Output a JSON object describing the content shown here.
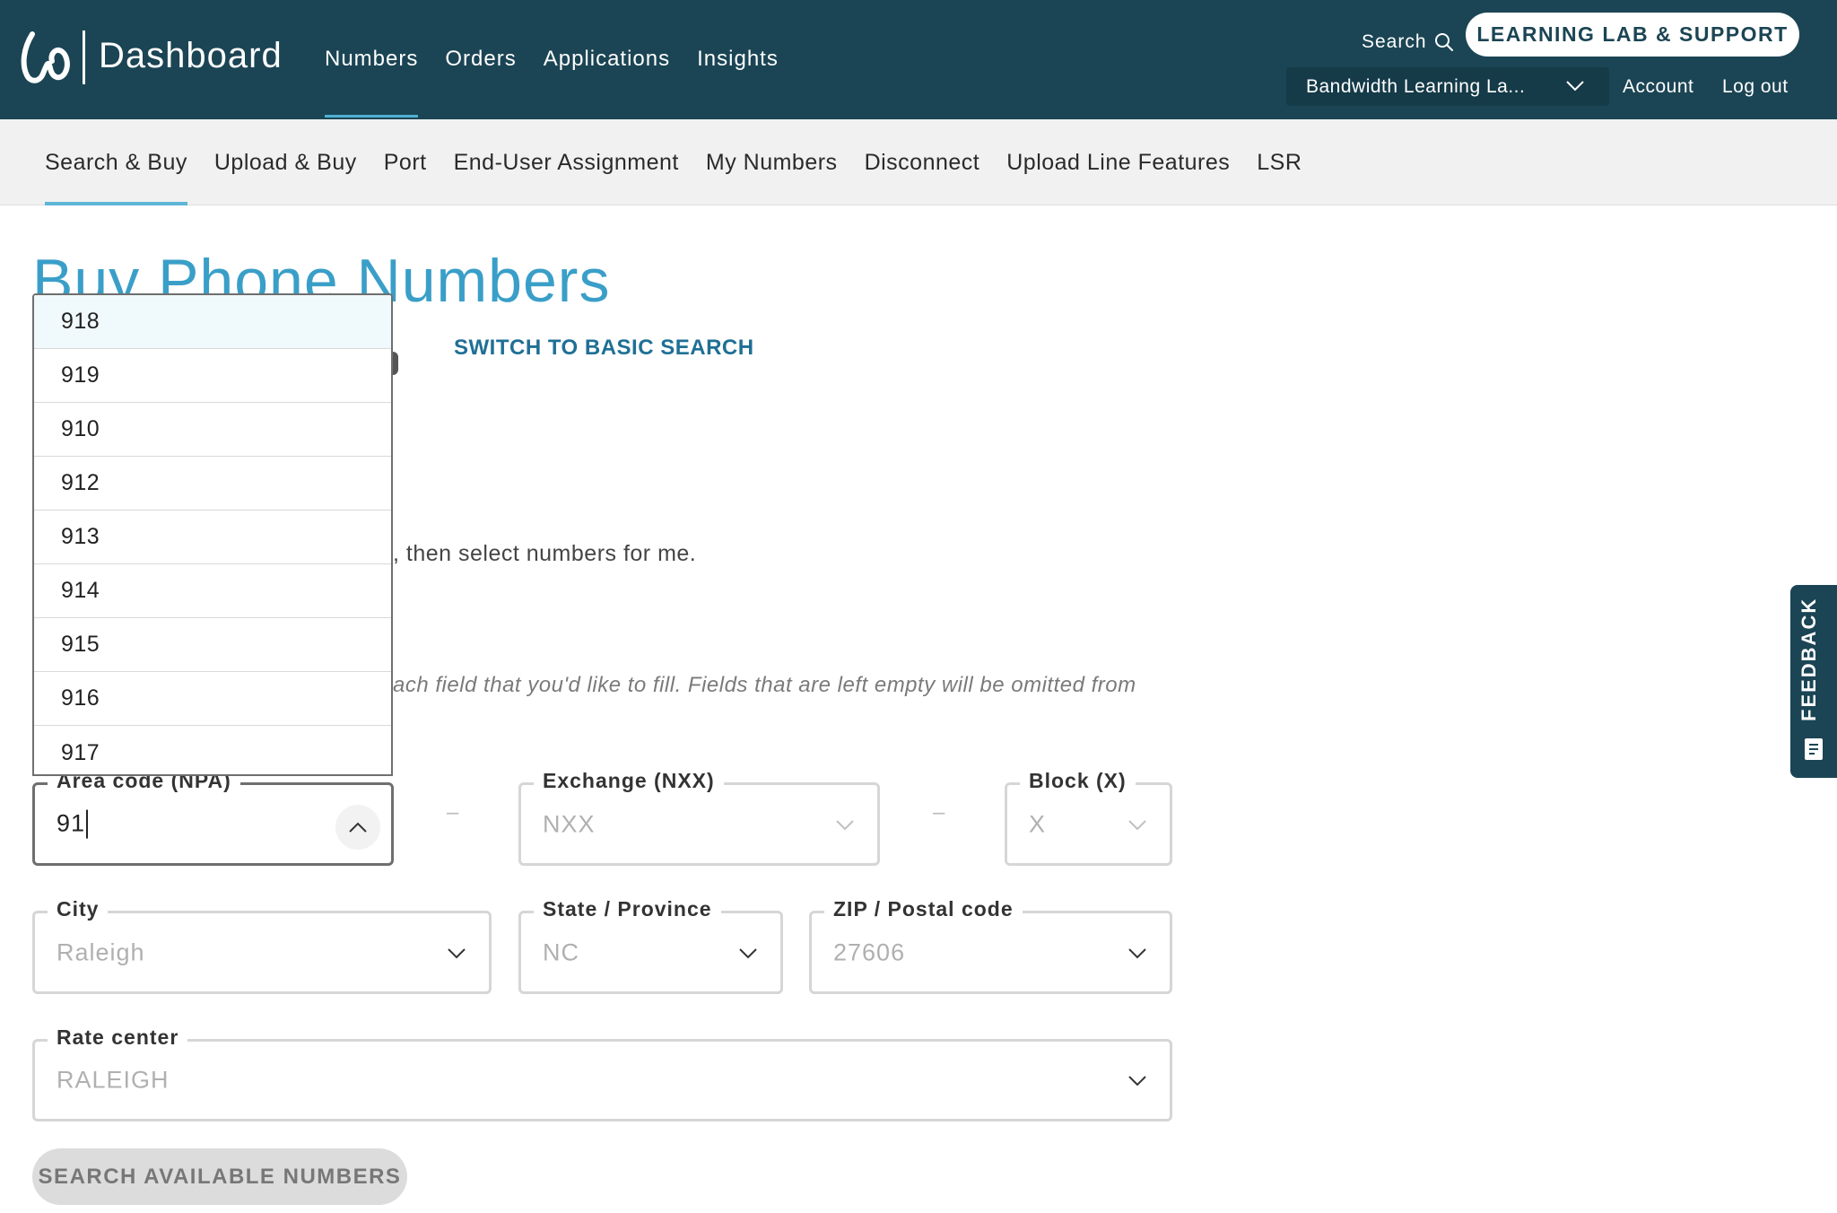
{
  "header": {
    "brand_title": "Dashboard",
    "main_nav": [
      "Numbers",
      "Orders",
      "Applications",
      "Insights"
    ],
    "active_main_nav": "Numbers",
    "search_label": "Search",
    "support_button": "LEARNING LAB & SUPPORT",
    "account_select": "Bandwidth Learning La...",
    "account_link": "Account",
    "logout_link": "Log out"
  },
  "subnav": {
    "items": [
      "Search & Buy",
      "Upload & Buy",
      "Port",
      "End-User Assignment",
      "My Numbers",
      "Disconnect",
      "Upload Line Features",
      "LSR"
    ],
    "active": "Search & Buy"
  },
  "main": {
    "page_title": "Buy Phone Numbers",
    "switch_link": "SWITCH TO BASIC SEARCH",
    "helper_text": ", then select numbers for me.",
    "instruction_text": "ach field that you'd like to fill. Fields that are left empty will be omitted from"
  },
  "form": {
    "area_code": {
      "label": "Area code (NPA)",
      "value": "91"
    },
    "exchange": {
      "label": "Exchange (NXX)",
      "placeholder": "NXX"
    },
    "block": {
      "label": "Block (X)",
      "placeholder": "X"
    },
    "dash": "–",
    "city": {
      "label": "City",
      "placeholder": "Raleigh"
    },
    "state": {
      "label": "State / Province",
      "placeholder": "NC"
    },
    "zip": {
      "label": "ZIP / Postal code",
      "placeholder": "27606"
    },
    "rate_center": {
      "label": "Rate center",
      "placeholder": "RALEIGH"
    },
    "search_button": "SEARCH AVAILABLE NUMBERS"
  },
  "dropdown": {
    "options": [
      "918",
      "919",
      "910",
      "912",
      "913",
      "914",
      "915",
      "916",
      "917"
    ],
    "highlighted_index": 0
  },
  "feedback": {
    "label": "FEEDBACK"
  },
  "colors": {
    "header_bg": "#1b4554",
    "accent": "#3a9fc8",
    "link": "#1f6f95"
  }
}
